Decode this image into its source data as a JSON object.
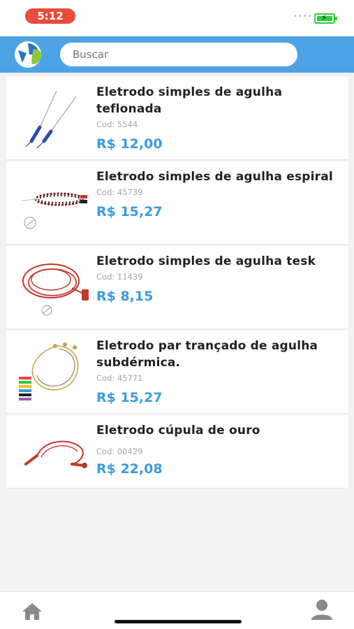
{
  "status_bar": {
    "time": "5:12"
  },
  "search": {
    "placeholder": "Buscar"
  },
  "products": [
    {
      "title": "Eletrodo simples de agulha teflonada",
      "code": "Cod: 5544",
      "price": "R$ 12,00"
    },
    {
      "title": "Eletrodo simples de agulha espiral",
      "code": "Cod: 45739",
      "price": "R$ 15,27"
    },
    {
      "title": "Eletrodo simples de agulha tesk",
      "code": "Cod: 11439",
      "price": "R$ 8,15"
    },
    {
      "title": "Eletrodo par trançado de agulha subdérmica.",
      "code": "Cod: 45771",
      "price": "R$ 15,27"
    },
    {
      "title": "Eletrodo cúpula de ouro",
      "code": "Cod: 00429",
      "price": "R$ 22,08"
    }
  ],
  "colors": {
    "header": "#4ea3e6",
    "price": "#3a9be0",
    "time_pill": "#e74c3c"
  },
  "icons": {
    "home": "home-icon",
    "profile": "profile-icon",
    "logo": "app-logo"
  }
}
